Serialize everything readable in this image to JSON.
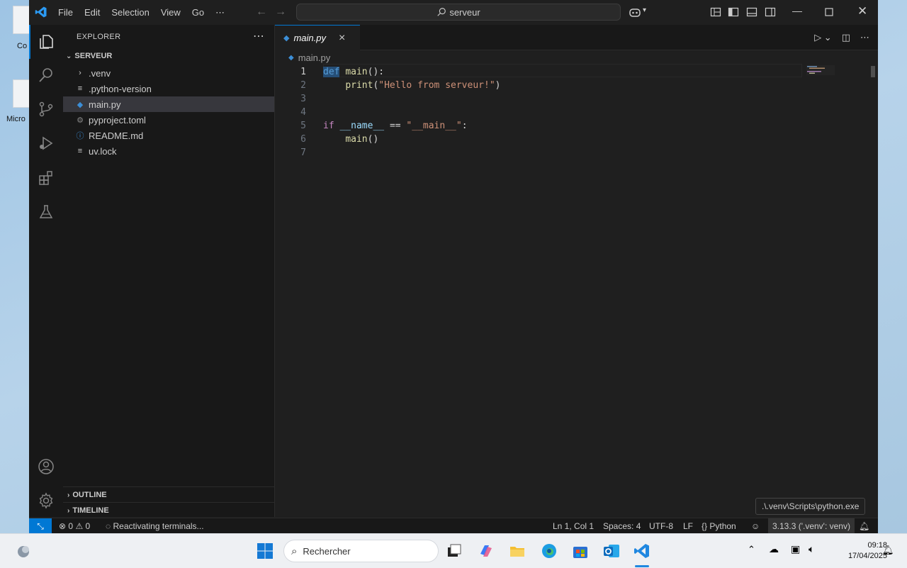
{
  "desktop": {
    "icons": [
      {
        "label": "Co"
      },
      {
        "label": "Micro"
      }
    ]
  },
  "titlebar": {
    "menu": [
      "File",
      "Edit",
      "Selection",
      "View",
      "Go",
      "⋯"
    ],
    "search_text": "serveur"
  },
  "explorer": {
    "title": "EXPLORER",
    "more": "⋯",
    "folder": "SERVEUR",
    "items": [
      {
        "label": ".venv",
        "icon": "chevron-right-icon"
      },
      {
        "label": ".python-version",
        "icon": "lines-icon"
      },
      {
        "label": "main.py",
        "icon": "python-icon",
        "selected": true
      },
      {
        "label": "pyproject.toml",
        "icon": "gear-icon"
      },
      {
        "label": "README.md",
        "icon": "info-icon"
      },
      {
        "label": "uv.lock",
        "icon": "lines-icon"
      }
    ],
    "outline": "OUTLINE",
    "timeline": "TIMELINE"
  },
  "editor": {
    "tab_label": "main.py",
    "breadcrumb": "main.py",
    "line_numbers": [
      "1",
      "2",
      "3",
      "4",
      "5",
      "6",
      "7"
    ]
  },
  "statusbar": {
    "problems": "0",
    "warnings": "0",
    "activity": "Reactivating terminals...",
    "position": "Ln 1, Col 1",
    "spaces": "Spaces: 4",
    "encoding": "UTF-8",
    "eol": "LF",
    "language": "Python",
    "interpreter": "3.13.3 ('.venv': venv)",
    "tooltip": ".\\.venv\\Scripts\\python.exe"
  },
  "taskbar": {
    "search_placeholder": "Rechercher",
    "time": "09:18",
    "date": "17/04/2025"
  }
}
